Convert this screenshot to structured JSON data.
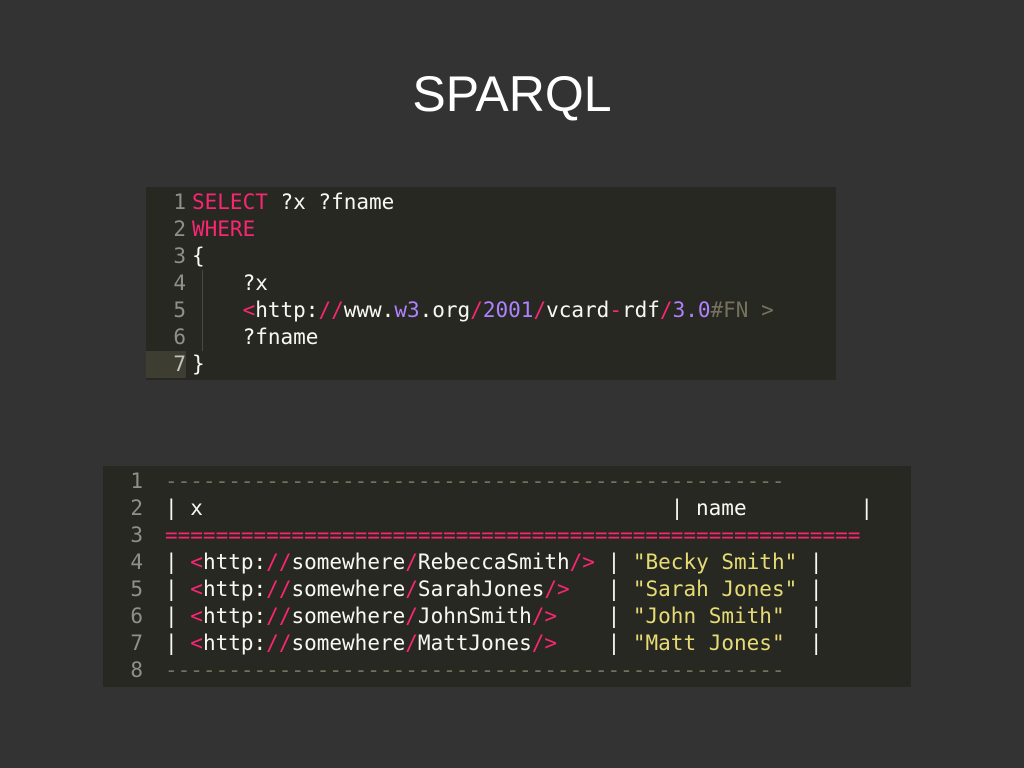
{
  "slide": {
    "title": "SPARQL"
  },
  "query_editor": {
    "active_line": 7,
    "lines": [
      {
        "n": "1",
        "tokens": [
          {
            "t": "SELECT",
            "c": "kw"
          },
          {
            "t": " ?x ?fname",
            "c": "plain"
          }
        ]
      },
      {
        "n": "2",
        "tokens": [
          {
            "t": "WHERE",
            "c": "kw"
          }
        ]
      },
      {
        "n": "3",
        "tokens": [
          {
            "t": "{",
            "c": "plain"
          }
        ]
      },
      {
        "n": "4",
        "tokens": [
          {
            "t": "    ?x",
            "c": "plain"
          }
        ]
      },
      {
        "n": "5",
        "tokens": [
          {
            "t": "    ",
            "c": "plain"
          },
          {
            "t": "<",
            "c": "op"
          },
          {
            "t": "http:",
            "c": "plain"
          },
          {
            "t": "//",
            "c": "op"
          },
          {
            "t": "www.",
            "c": "plain"
          },
          {
            "t": "w3",
            "c": "num"
          },
          {
            "t": ".org",
            "c": "plain"
          },
          {
            "t": "/",
            "c": "op"
          },
          {
            "t": "2001",
            "c": "num"
          },
          {
            "t": "/",
            "c": "op"
          },
          {
            "t": "vcard",
            "c": "plain"
          },
          {
            "t": "-",
            "c": "op"
          },
          {
            "t": "rdf",
            "c": "plain"
          },
          {
            "t": "/",
            "c": "op"
          },
          {
            "t": "3.0",
            "c": "num"
          },
          {
            "t": "#FN >",
            "c": "comment"
          }
        ]
      },
      {
        "n": "6",
        "tokens": [
          {
            "t": "    ?fname",
            "c": "plain"
          }
        ]
      },
      {
        "n": "7",
        "tokens": [
          {
            "t": "}",
            "c": "plain"
          }
        ]
      }
    ]
  },
  "results_output": {
    "lines": [
      {
        "n": "1",
        "tokens": [
          {
            "t": "-------------------------------------------------",
            "c": "dash"
          }
        ]
      },
      {
        "n": "2",
        "tokens": [
          {
            "t": "| x                                     | name         |",
            "c": "plain"
          }
        ]
      },
      {
        "n": "3",
        "tokens": [
          {
            "t": "=======================================================",
            "c": "op"
          }
        ]
      },
      {
        "n": "4",
        "tokens": [
          {
            "t": "| ",
            "c": "plain"
          },
          {
            "t": "<",
            "c": "op"
          },
          {
            "t": "http:",
            "c": "plain"
          },
          {
            "t": "//",
            "c": "op"
          },
          {
            "t": "somewhere",
            "c": "plain"
          },
          {
            "t": "/",
            "c": "op"
          },
          {
            "t": "RebeccaSmith",
            "c": "plain"
          },
          {
            "t": "/>",
            "c": "op"
          },
          {
            "t": " | ",
            "c": "plain"
          },
          {
            "t": "\"Becky Smith\"",
            "c": "str"
          },
          {
            "t": " |",
            "c": "plain"
          }
        ]
      },
      {
        "n": "5",
        "tokens": [
          {
            "t": "| ",
            "c": "plain"
          },
          {
            "t": "<",
            "c": "op"
          },
          {
            "t": "http:",
            "c": "plain"
          },
          {
            "t": "//",
            "c": "op"
          },
          {
            "t": "somewhere",
            "c": "plain"
          },
          {
            "t": "/",
            "c": "op"
          },
          {
            "t": "SarahJones",
            "c": "plain"
          },
          {
            "t": "/>",
            "c": "op"
          },
          {
            "t": "   | ",
            "c": "plain"
          },
          {
            "t": "\"Sarah Jones\"",
            "c": "str"
          },
          {
            "t": " |",
            "c": "plain"
          }
        ]
      },
      {
        "n": "6",
        "tokens": [
          {
            "t": "| ",
            "c": "plain"
          },
          {
            "t": "<",
            "c": "op"
          },
          {
            "t": "http:",
            "c": "plain"
          },
          {
            "t": "//",
            "c": "op"
          },
          {
            "t": "somewhere",
            "c": "plain"
          },
          {
            "t": "/",
            "c": "op"
          },
          {
            "t": "JohnSmith",
            "c": "plain"
          },
          {
            "t": "/>",
            "c": "op"
          },
          {
            "t": "    | ",
            "c": "plain"
          },
          {
            "t": "\"John Smith\"",
            "c": "str"
          },
          {
            "t": "  |",
            "c": "plain"
          }
        ]
      },
      {
        "n": "7",
        "tokens": [
          {
            "t": "| ",
            "c": "plain"
          },
          {
            "t": "<",
            "c": "op"
          },
          {
            "t": "http:",
            "c": "plain"
          },
          {
            "t": "//",
            "c": "op"
          },
          {
            "t": "somewhere",
            "c": "plain"
          },
          {
            "t": "/",
            "c": "op"
          },
          {
            "t": "MattJones",
            "c": "plain"
          },
          {
            "t": "/>",
            "c": "op"
          },
          {
            "t": "    | ",
            "c": "plain"
          },
          {
            "t": "\"Matt Jones\"",
            "c": "str"
          },
          {
            "t": "  |",
            "c": "plain"
          }
        ]
      },
      {
        "n": "8",
        "tokens": [
          {
            "t": "-------------------------------------------------",
            "c": "dash"
          }
        ]
      }
    ]
  }
}
